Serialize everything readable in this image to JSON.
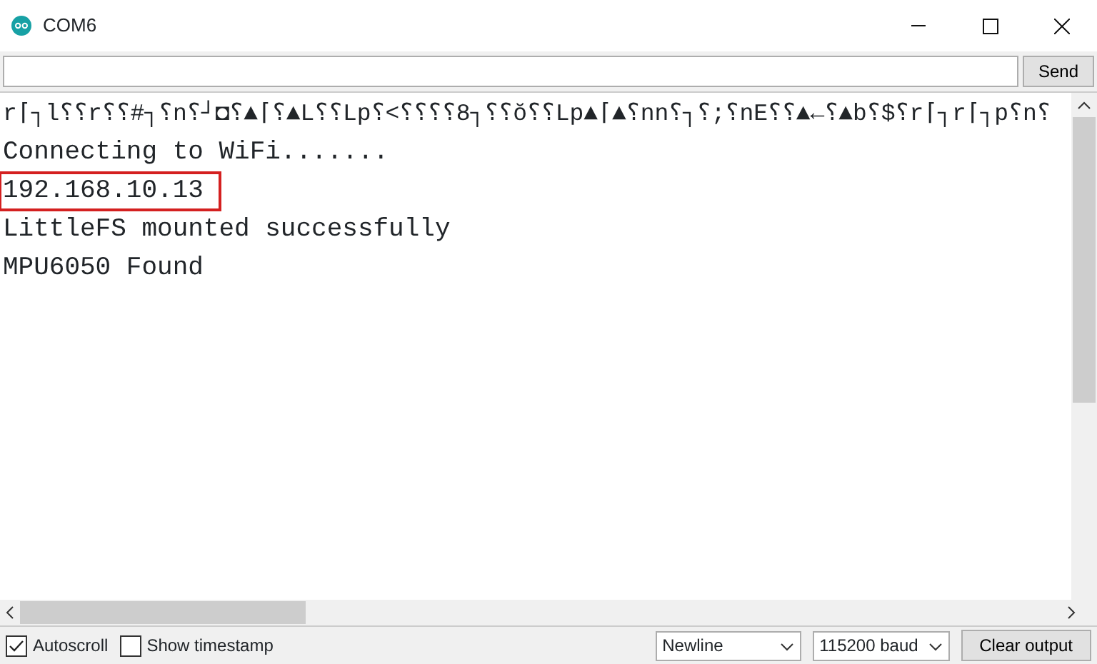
{
  "window": {
    "title": "COM6"
  },
  "send_button": "Send",
  "output_lines": [
    {
      "text": "r⌈┐l⸮⸮r⸮⸮#┐⸮n⸮┘◘⸮▲⌈⸮▲L⸮⸮Lp⸮<⸮⸮⸮⸮8┐⸮⸮ŏ⸮⸮Lp▲⌈▲⸮nn⸮┐⸮;⸮nE⸮⸮▲←⸮▲b⸮$⸮r⌈┐r⌈┐p⸮n⸮",
      "highlighted": false
    },
    {
      "text": "Connecting to WiFi.......",
      "highlighted": false
    },
    {
      "text": "192.168.10.13",
      "highlighted": true
    },
    {
      "text": "LittleFS mounted successfully",
      "highlighted": false
    },
    {
      "text": "MPU6050 Found",
      "highlighted": false
    }
  ],
  "autoscroll": {
    "label": "Autoscroll",
    "checked": true
  },
  "show_timestamp": {
    "label": "Show timestamp",
    "checked": false
  },
  "line_ending": "Newline",
  "baud_rate": "115200 baud",
  "clear_button": "Clear output"
}
